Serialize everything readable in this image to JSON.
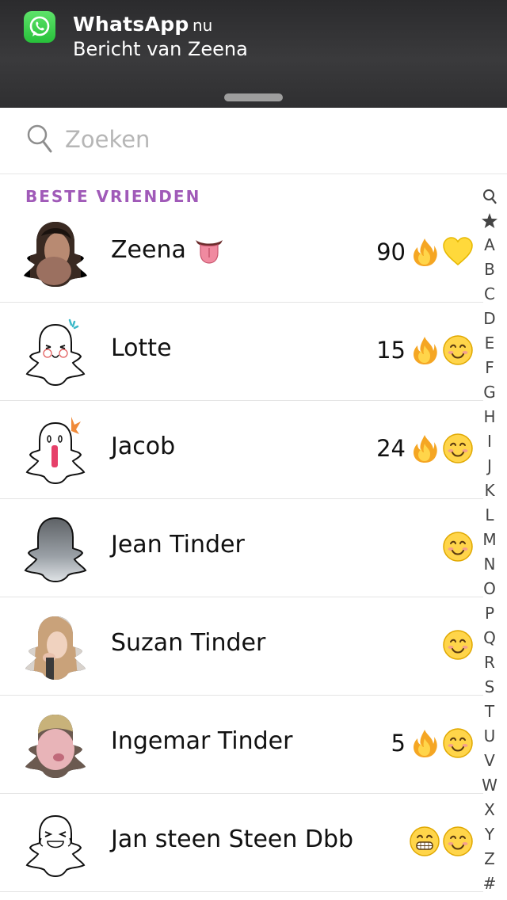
{
  "notification": {
    "app": "WhatsApp",
    "time": "nu",
    "message": "Bericht van Zeena",
    "icon": "whatsapp-icon"
  },
  "search": {
    "placeholder": "Zoeken",
    "value": ""
  },
  "section_title": "BESTE VRIENDEN",
  "friends": [
    {
      "name": "Zeena",
      "name_emoji": "tongue-emoji",
      "streak": "90",
      "icons": [
        "fire-emoji",
        "yellow-heart-emoji"
      ],
      "avatar": "photo-avatar"
    },
    {
      "name": "Lotte",
      "streak": "15",
      "icons": [
        "fire-emoji",
        "smile-emoji"
      ],
      "avatar": "ghost-blushing-avatar"
    },
    {
      "name": "Jacob",
      "streak": "24",
      "icons": [
        "fire-emoji",
        "smile-emoji"
      ],
      "avatar": "ghost-screaming-avatar"
    },
    {
      "name": "Jean Tinder",
      "streak": "",
      "icons": [
        "smile-emoji"
      ],
      "avatar": "ghost-grey-avatar"
    },
    {
      "name": "Suzan Tinder",
      "streak": "",
      "icons": [
        "smile-emoji"
      ],
      "avatar": "photo-avatar"
    },
    {
      "name": "Ingemar Tinder",
      "streak": "5",
      "icons": [
        "fire-emoji",
        "smile-emoji"
      ],
      "avatar": "photo-avatar"
    },
    {
      "name": "Jan steen Steen Dbb",
      "streak": "",
      "icons": [
        "grin-emoji",
        "smile-emoji"
      ],
      "avatar": "ghost-laughing-avatar"
    }
  ],
  "alphabet_index": [
    "search-icon",
    "star-icon",
    "A",
    "B",
    "C",
    "D",
    "E",
    "F",
    "G",
    "H",
    "I",
    "J",
    "K",
    "L",
    "M",
    "N",
    "O",
    "P",
    "Q",
    "R",
    "S",
    "T",
    "U",
    "V",
    "W",
    "X",
    "Y",
    "Z",
    "#"
  ],
  "colors": {
    "section_title": "#a05ab8",
    "whatsapp_green": "#2fc548"
  }
}
